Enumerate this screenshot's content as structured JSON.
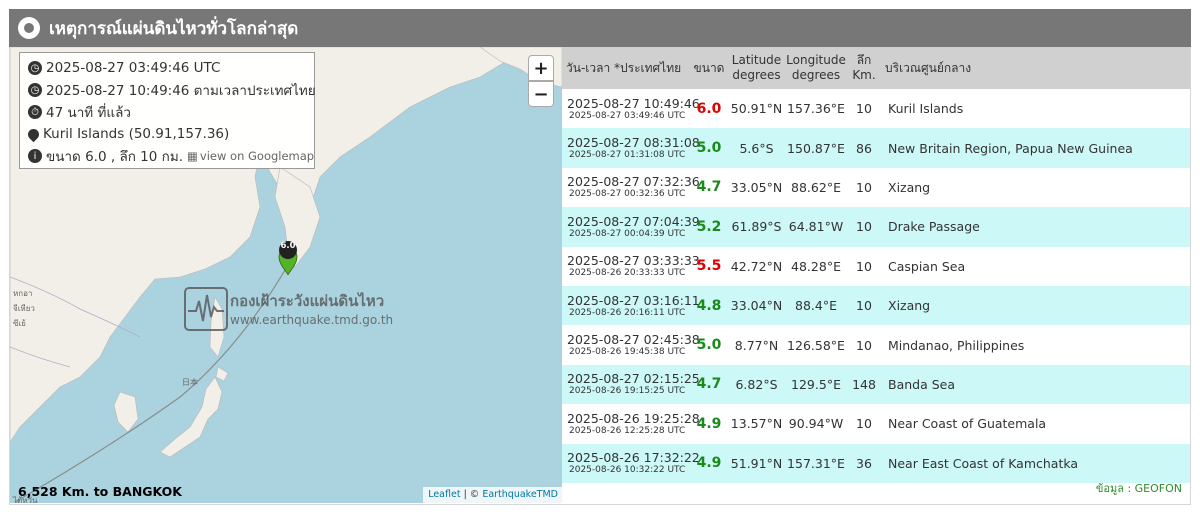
{
  "header": {
    "title": "เหตุการณ์แผ่นดินไหวทั่วโลกล่าสุด"
  },
  "info": {
    "utc_time": "2025-08-27 03:49:46 UTC",
    "local_time": "2025-08-27 10:49:46 ตามเวลาประเทศไทย",
    "ago": "47 นาที ที่แล้ว",
    "location": "Kuril Islands (50.91,157.36)",
    "magnitude_depth": "ขนาด 6.0 , ลึก 10 กม.",
    "googlemap_label": "view on Googlemap"
  },
  "map": {
    "zoom_in": "+",
    "zoom_out": "−",
    "marker_value": "6.0",
    "watermark_title": "กองเฝ้าระวังแผ่นดินไหว",
    "watermark_url": "www.earthquake.tmd.go.th",
    "label_japan": "日本",
    "label_a": "หกอา",
    "label_b": "จีเหียว",
    "label_c": "ซีเย้",
    "label_d": "ไต้หวัน",
    "distance": "6,528 Km. to BANGKOK",
    "attribution_leaflet": "Leaflet",
    "attribution_sep": " | © ",
    "attribution_tmd": "EarthquakeTMD"
  },
  "table": {
    "headers": {
      "time": "วัน-เวลา *ประเทศไทย",
      "mag": "ขนาด",
      "lat1": "Latitude",
      "lat2": "degrees",
      "lon1": "Longitude",
      "lon2": "degrees",
      "dep1": "ลึก",
      "dep2": "Km.",
      "region": "บริเวณศูนย์กลาง"
    },
    "rows": [
      {
        "local": "2025-08-27 10:49:46",
        "utc": "2025-08-27 03:49:46 UTC",
        "mag": "6.0",
        "lat": "50.91°N",
        "lon": "157.36°E",
        "depth": "10",
        "region": "Kuril Islands"
      },
      {
        "local": "2025-08-27 08:31:08",
        "utc": "2025-08-27 01:31:08 UTC",
        "mag": "5.0",
        "lat": "5.6°S",
        "lon": "150.87°E",
        "depth": "86",
        "region": "New Britain Region, Papua New Guinea"
      },
      {
        "local": "2025-08-27 07:32:36",
        "utc": "2025-08-27 00:32:36 UTC",
        "mag": "4.7",
        "lat": "33.05°N",
        "lon": "88.62°E",
        "depth": "10",
        "region": "Xizang"
      },
      {
        "local": "2025-08-27 07:04:39",
        "utc": "2025-08-27 00:04:39 UTC",
        "mag": "5.2",
        "lat": "61.89°S",
        "lon": "64.81°W",
        "depth": "10",
        "region": "Drake Passage"
      },
      {
        "local": "2025-08-27 03:33:33",
        "utc": "2025-08-26 20:33:33 UTC",
        "mag": "5.5",
        "lat": "42.72°N",
        "lon": "48.28°E",
        "depth": "10",
        "region": "Caspian Sea"
      },
      {
        "local": "2025-08-27 03:16:11",
        "utc": "2025-08-26 20:16:11 UTC",
        "mag": "4.8",
        "lat": "33.04°N",
        "lon": "88.4°E",
        "depth": "10",
        "region": "Xizang"
      },
      {
        "local": "2025-08-27 02:45:38",
        "utc": "2025-08-26 19:45:38 UTC",
        "mag": "5.0",
        "lat": "8.77°N",
        "lon": "126.58°E",
        "depth": "10",
        "region": "Mindanao, Philippines"
      },
      {
        "local": "2025-08-27 02:15:25",
        "utc": "2025-08-26 19:15:25 UTC",
        "mag": "4.7",
        "lat": "6.82°S",
        "lon": "129.5°E",
        "depth": "148",
        "region": "Banda Sea"
      },
      {
        "local": "2025-08-26 19:25:28",
        "utc": "2025-08-26 12:25:28 UTC",
        "mag": "4.9",
        "lat": "13.57°N",
        "lon": "90.94°W",
        "depth": "10",
        "region": "Near Coast of Guatemala"
      },
      {
        "local": "2025-08-26 17:32:22",
        "utc": "2025-08-26 10:32:22 UTC",
        "mag": "4.9",
        "lat": "51.91°N",
        "lon": "157.31°E",
        "depth": "36",
        "region": "Near East Coast of Kamchatka"
      }
    ]
  },
  "source": "ข้อมูล : GEOFON",
  "colors": {
    "mag_strong": "#e00000",
    "mag_normal": "#1a8a1a",
    "row_alt": "#ccf8f8",
    "header_bar": "#777777"
  }
}
